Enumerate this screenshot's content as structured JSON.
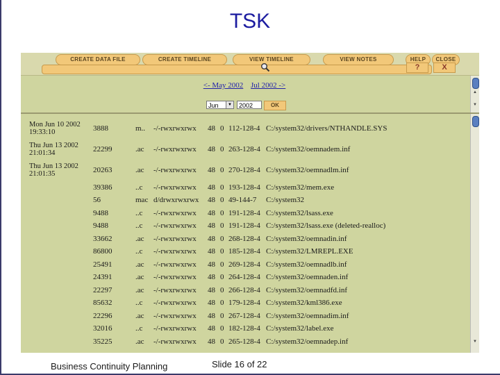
{
  "slide": {
    "title": "TSK",
    "footer_left": "Business Continuity Planning",
    "footer_right": "Slide 16 of 22"
  },
  "toolbar": {
    "buttons": [
      "CREATE DATA FILE",
      "CREATE TIMELINE",
      "VIEW TIMELINE",
      "VIEW NOTES",
      "HELP",
      "CLOSE"
    ],
    "help_glyph": "?",
    "close_glyph": "X"
  },
  "nav": {
    "prev_link": "<- May 2002",
    "next_link": "Jul 2002 ->",
    "month_value": "Jun",
    "year_value": "2002",
    "ok_label": "OK"
  },
  "timeline": {
    "rows": [
      {
        "date": "Mon Jun 10 2002",
        "time": "19:33:10",
        "size": "3888",
        "mac": "m..",
        "mode": "-/-rwxrwxrwx",
        "uid": "48",
        "gid": "0",
        "inode": "112-128-4",
        "file": "C:/system32/drivers/NTHANDLE.SYS"
      },
      {
        "date": "Thu Jun 13 2002",
        "time": "21:01:34",
        "size": "22299",
        "mac": ".ac",
        "mode": "-/-rwxrwxrwx",
        "uid": "48",
        "gid": "0",
        "inode": "263-128-4",
        "file": "C:/system32/oemnadem.inf"
      },
      {
        "date": "Thu Jun 13 2002",
        "time": "21:01:35",
        "size": "20263",
        "mac": ".ac",
        "mode": "-/-rwxrwxrwx",
        "uid": "48",
        "gid": "0",
        "inode": "270-128-4",
        "file": "C:/system32/oemnadlm.inf"
      },
      {
        "date": "",
        "time": "",
        "size": "39386",
        "mac": "..c",
        "mode": "-/-rwxrwxrwx",
        "uid": "48",
        "gid": "0",
        "inode": "193-128-4",
        "file": "C:/system32/mem.exe"
      },
      {
        "date": "",
        "time": "",
        "size": "56",
        "mac": "mac",
        "mode": "d/drwxrwxrwx",
        "uid": "48",
        "gid": "0",
        "inode": "49-144-7",
        "file": "C:/system32"
      },
      {
        "date": "",
        "time": "",
        "size": "9488",
        "mac": "..c",
        "mode": "-/-rwxrwxrwx",
        "uid": "48",
        "gid": "0",
        "inode": "191-128-4",
        "file": "C:/system32/lsass.exe"
      },
      {
        "date": "",
        "time": "",
        "size": "9488",
        "mac": "..c",
        "mode": "-/-rwxrwxrwx",
        "uid": "48",
        "gid": "0",
        "inode": "191-128-4",
        "file": "C:/system32/lsass.exe (deleted-realloc)"
      },
      {
        "date": "",
        "time": "",
        "size": "33662",
        "mac": ".ac",
        "mode": "-/-rwxrwxrwx",
        "uid": "48",
        "gid": "0",
        "inode": "268-128-4",
        "file": "C:/system32/oemnadin.inf"
      },
      {
        "date": "",
        "time": "",
        "size": "86800",
        "mac": "..c",
        "mode": "-/-rwxrwxrwx",
        "uid": "48",
        "gid": "0",
        "inode": "185-128-4",
        "file": "C:/system32/LMREPL.EXE"
      },
      {
        "date": "",
        "time": "",
        "size": "25491",
        "mac": ".ac",
        "mode": "-/-rwxrwxrwx",
        "uid": "48",
        "gid": "0",
        "inode": "269-128-4",
        "file": "C:/system32/oemnadlb.inf"
      },
      {
        "date": "",
        "time": "",
        "size": "24391",
        "mac": ".ac",
        "mode": "-/-rwxrwxrwx",
        "uid": "48",
        "gid": "0",
        "inode": "264-128-4",
        "file": "C:/system32/oemnaden.inf"
      },
      {
        "date": "",
        "time": "",
        "size": "22297",
        "mac": ".ac",
        "mode": "-/-rwxrwxrwx",
        "uid": "48",
        "gid": "0",
        "inode": "266-128-4",
        "file": "C:/system32/oemnadfd.inf"
      },
      {
        "date": "",
        "time": "",
        "size": "85632",
        "mac": "..c",
        "mode": "-/-rwxrwxrwx",
        "uid": "48",
        "gid": "0",
        "inode": "179-128-4",
        "file": "C:/system32/kml386.exe"
      },
      {
        "date": "",
        "time": "",
        "size": "22296",
        "mac": ".ac",
        "mode": "-/-rwxrwxrwx",
        "uid": "48",
        "gid": "0",
        "inode": "267-128-4",
        "file": "C:/system32/oemnadim.inf"
      },
      {
        "date": "",
        "time": "",
        "size": "32016",
        "mac": "..c",
        "mode": "-/-rwxrwxrwx",
        "uid": "48",
        "gid": "0",
        "inode": "182-128-4",
        "file": "C:/system32/label.exe"
      },
      {
        "date": "",
        "time": "",
        "size": "35225",
        "mac": ".ac",
        "mode": "-/-rwxrwxrwx",
        "uid": "48",
        "gid": "0",
        "inode": "265-128-4",
        "file": "C:/system32/oemnadep.inf"
      }
    ]
  },
  "colors": {
    "panel_bg": "#cfd59f",
    "button_fill": "#f2c879",
    "link": "#2222aa",
    "title": "#1c1ca0"
  }
}
